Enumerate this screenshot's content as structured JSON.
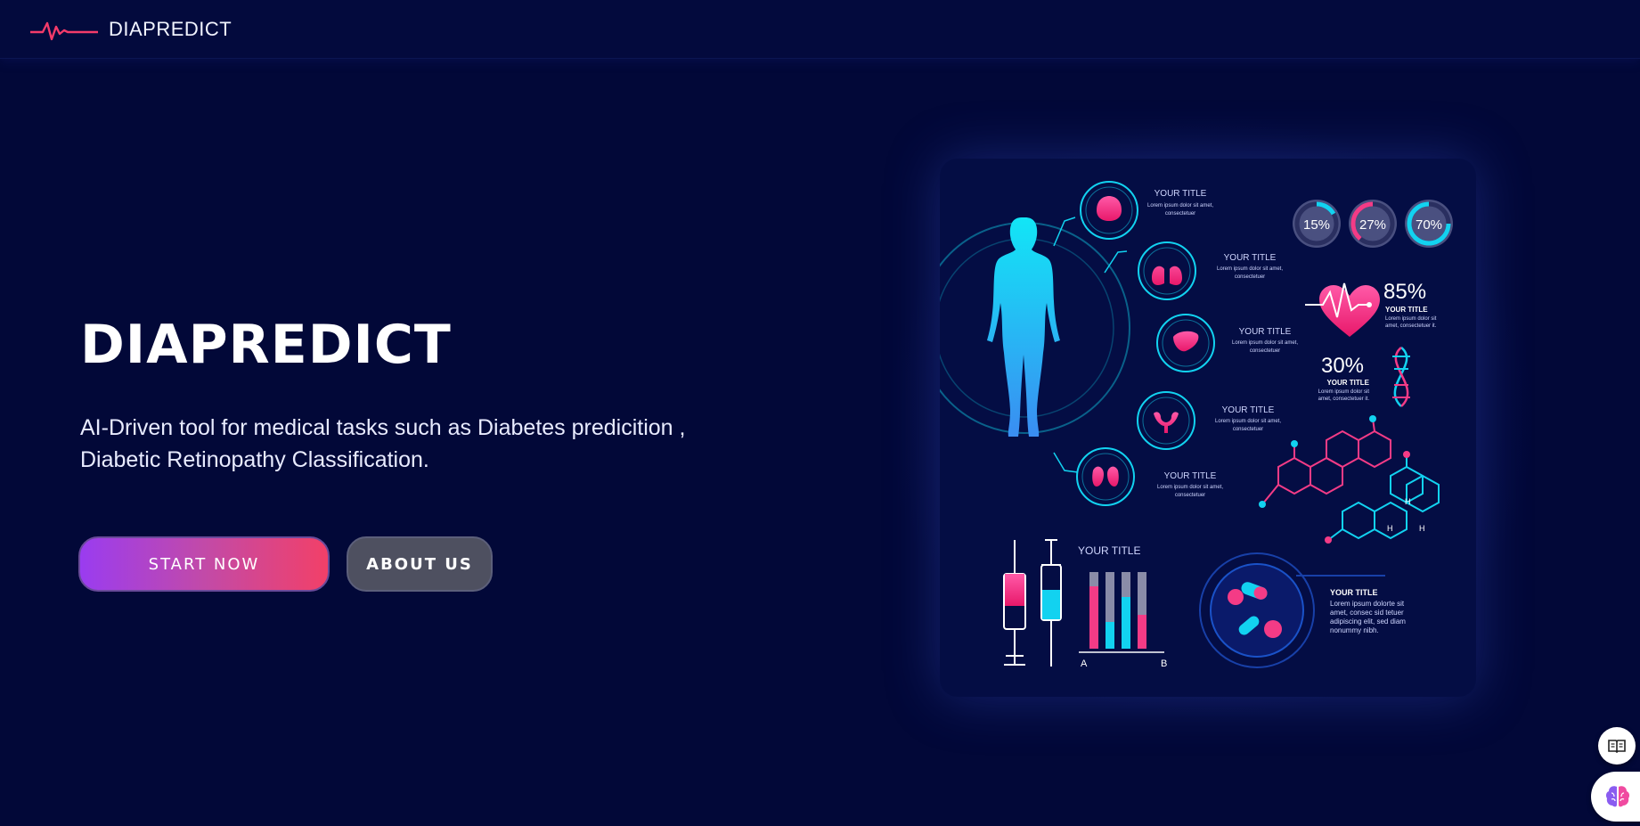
{
  "header": {
    "brand_name": "DIAPREDICT",
    "logo_icon": "heartbeat-pulse-icon",
    "accent": "#f43b6a"
  },
  "hero": {
    "title": "DIAPREDICT",
    "description": "AI-Driven tool for medical tasks such as Diabetes predicition , Diabetic Retinopathy Classification.",
    "start_label": "START NOW",
    "about_label": "ABOUT US"
  },
  "infographic": {
    "organ_titles": [
      "YOUR TITLE",
      "YOUR TITLE",
      "YOUR TITLE",
      "YOUR TITLE",
      "YOUR TITLE"
    ],
    "organ_icons": [
      "brain-icon",
      "lungs-icon",
      "liver-icon",
      "uterus-icon",
      "kidneys-icon"
    ],
    "lorem_short_1": "Lorem ipsum dolor sit amet,",
    "lorem_short_2": "consectetuer",
    "gauges": [
      "15%",
      "27%",
      "70%"
    ],
    "heart_stat": "85%",
    "heart_title": "YOUR TITLE",
    "heart_text_1": "Lorem ipsum dolor sit",
    "heart_text_2": "amet, consectetuer it.",
    "dna_stat": "30%",
    "dna_title": "YOUR TITLE",
    "dna_text_1": "Lorem ipsum dolor sit",
    "dna_text_2": "amet, consectetuer it.",
    "molecule_labels": [
      "H",
      "H",
      "H"
    ],
    "bar_chart_title": "YOUR TITLE",
    "bar_axis_a": "A",
    "bar_axis_b": "B",
    "pills_title": "YOUR TITLE",
    "pills_text": [
      "Lorem ipsum dolorte sit",
      "amet, consec sid tetuer",
      "adipiscing elit, sed diam",
      "nonummy nibh."
    ],
    "colors": {
      "cyan": "#12d2f0",
      "pink": "#f43b86",
      "card_bg": "#040d44"
    }
  },
  "widgets": {
    "reader_icon": "book-open-icon",
    "assistant_icon": "brain-icon"
  }
}
